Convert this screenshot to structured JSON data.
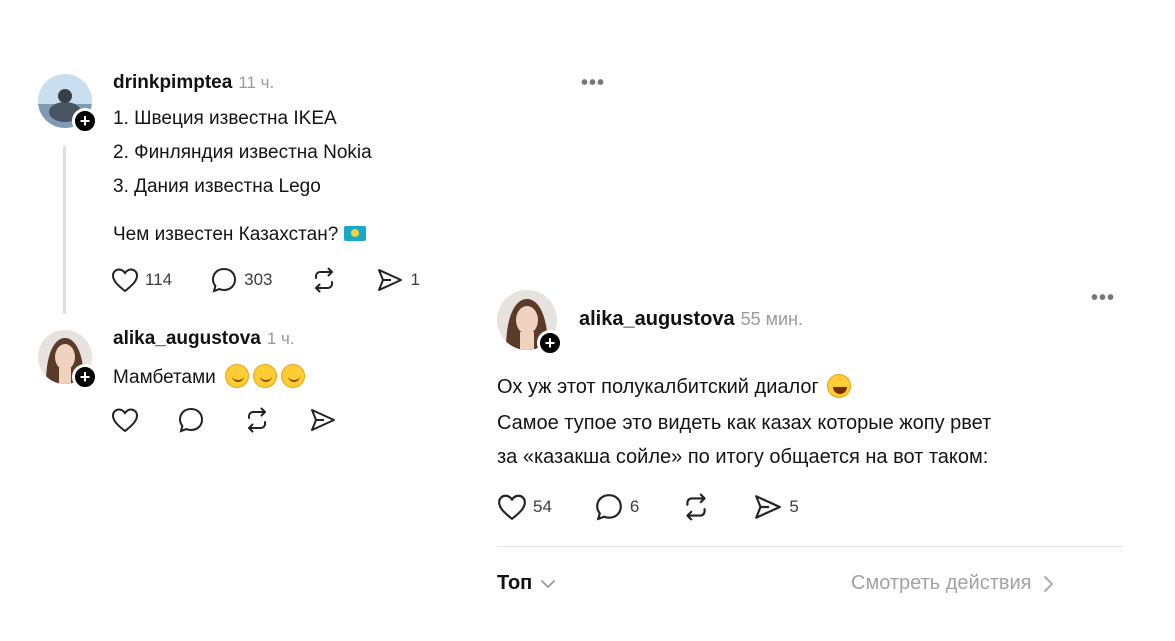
{
  "left_post": {
    "username": "drinkpimptea",
    "time": "11 ч.",
    "lines": [
      "1. Швеция известна IKEA",
      "2. Финляндия известна Nokia",
      "3. Дания известна Lego"
    ],
    "question": "Чем известен Казахстан?",
    "likes": "114",
    "comments": "303",
    "shares": "1"
  },
  "left_reply": {
    "username": "alika_augustova",
    "time": "1 ч.",
    "text": "Мамбетами"
  },
  "right_post": {
    "username": "alika_augustova",
    "time": "55 мин.",
    "lines": [
      "Ох уж этот полукалбитский диалог",
      "Самое тупое это видеть как казах которые жопу рвет",
      "за «казакша сойле» по итогу общается на вот таком:"
    ],
    "likes": "54",
    "comments": "6",
    "shares": "5"
  },
  "footer": {
    "sort_label": "Топ",
    "activity_link": "Смотреть действия"
  },
  "icons": {
    "more": "more-dots-icon",
    "like": "heart-icon",
    "comment": "comment-bubble-icon",
    "repost": "repost-icon",
    "share": "send-icon",
    "follow": "plus-icon"
  },
  "colors": {
    "text": "#101010",
    "muted": "#9a9a9a",
    "background": "#ffffff",
    "flag_blue": "#19a9c8",
    "flag_sun": "#f4d13a"
  }
}
